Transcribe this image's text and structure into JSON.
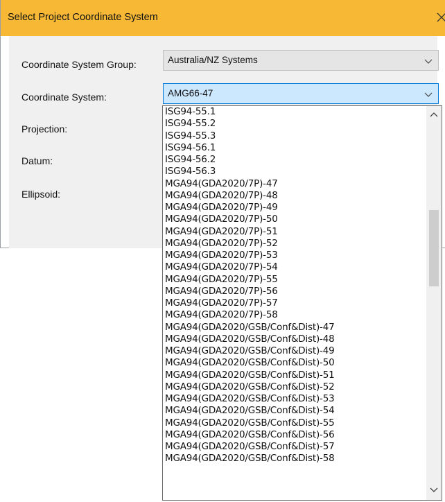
{
  "window": {
    "title": "Select Project Coordinate System",
    "close_icon": "close-icon",
    "colors": {
      "titlebar": "#f7b835",
      "accent": "#0078d7",
      "selected_bg": "#cce8ff"
    }
  },
  "form": {
    "group_label": "Coordinate System Group:",
    "group_value": "Australia/NZ Systems",
    "system_label": "Coordinate System:",
    "system_value": "AMG66-47",
    "projection_label": "Projection:",
    "datum_label": "Datum:",
    "ellipsoid_label": "Ellipsoid:"
  },
  "dropdown": {
    "items": [
      "ISG94-55.1",
      "ISG94-55.2",
      "ISG94-55.3",
      "ISG94-56.1",
      "ISG94-56.2",
      "ISG94-56.3",
      "MGA94(GDA2020/7P)-47",
      "MGA94(GDA2020/7P)-48",
      "MGA94(GDA2020/7P)-49",
      "MGA94(GDA2020/7P)-50",
      "MGA94(GDA2020/7P)-51",
      "MGA94(GDA2020/7P)-52",
      "MGA94(GDA2020/7P)-53",
      "MGA94(GDA2020/7P)-54",
      "MGA94(GDA2020/7P)-55",
      "MGA94(GDA2020/7P)-56",
      "MGA94(GDA2020/7P)-57",
      "MGA94(GDA2020/7P)-58",
      "MGA94(GDA2020/GSB/Conf&Dist)-47",
      "MGA94(GDA2020/GSB/Conf&Dist)-48",
      "MGA94(GDA2020/GSB/Conf&Dist)-49",
      "MGA94(GDA2020/GSB/Conf&Dist)-50",
      "MGA94(GDA2020/GSB/Conf&Dist)-51",
      "MGA94(GDA2020/GSB/Conf&Dist)-52",
      "MGA94(GDA2020/GSB/Conf&Dist)-53",
      "MGA94(GDA2020/GSB/Conf&Dist)-54",
      "MGA94(GDA2020/GSB/Conf&Dist)-55",
      "MGA94(GDA2020/GSB/Conf&Dist)-56",
      "MGA94(GDA2020/GSB/Conf&Dist)-57",
      "MGA94(GDA2020/GSB/Conf&Dist)-58"
    ],
    "icons": {
      "up": "chevron-up-icon",
      "down": "chevron-down-icon"
    }
  }
}
